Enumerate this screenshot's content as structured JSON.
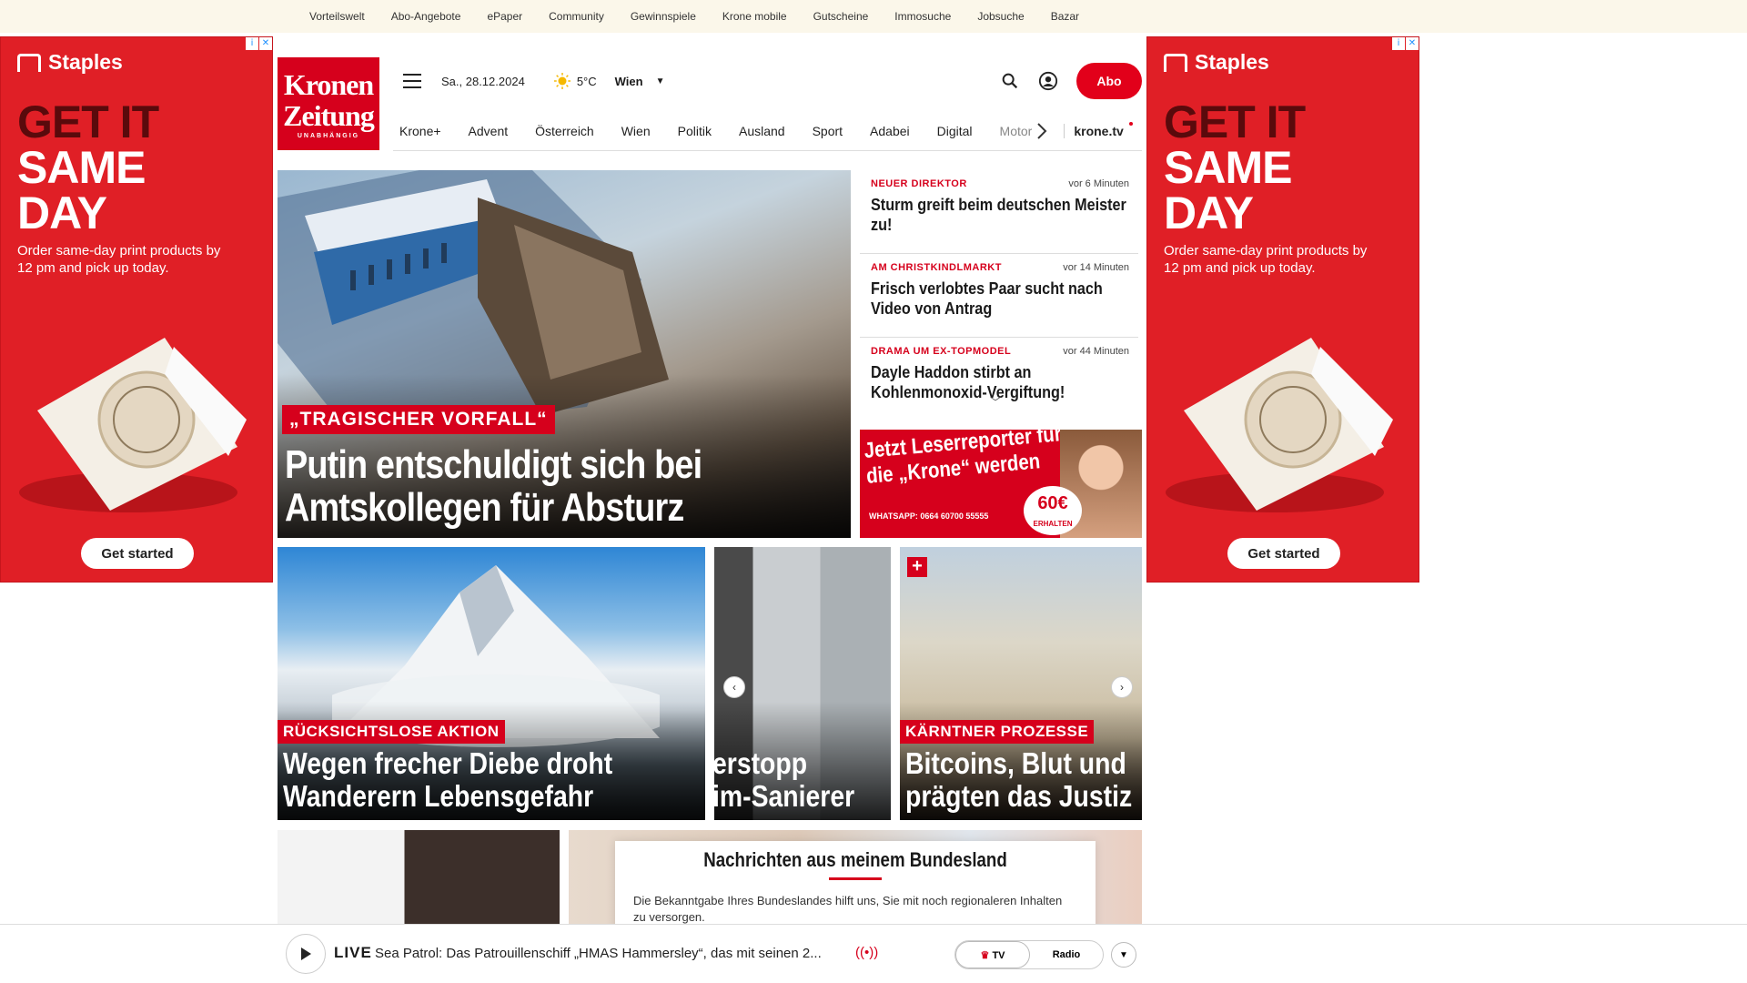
{
  "topbar": [
    "Vorteilswelt",
    "Abo-Angebote",
    "ePaper",
    "Community",
    "Gewinnspiele",
    "Krone mobile",
    "Gutscheine",
    "Immosuche",
    "Jobsuche",
    "Bazar"
  ],
  "ad": {
    "brand": "Staples",
    "line1": "GET IT",
    "line2": "SAME",
    "line3": "DAY",
    "sub": "Order same-day print products by 12 pm and pick up today.",
    "cta": "Get started",
    "adchoice_i": "i",
    "adchoice_x": "✕",
    "accent": "#e01f26"
  },
  "logo": {
    "l1": "Kronen",
    "l2": "Zeitung",
    "l3": "UNABHÄNGIG"
  },
  "header": {
    "date": "Sa., 28.12.2024",
    "temp": "5°C",
    "city": "Wien",
    "abo": "Abo"
  },
  "nav": [
    "Krone+",
    "Advent",
    "Österreich",
    "Wien",
    "Politik",
    "Ausland",
    "Sport",
    "Adabei",
    "Digital"
  ],
  "nav_more": "Motor",
  "nav_tv": "krone.tv",
  "hero": {
    "kicker": "„TRAGISCHER VORFALL“",
    "title": "Putin entschuldigt sich bei Amtskollegen für Absturz"
  },
  "news": [
    {
      "cat": "NEUER DIREKTOR",
      "time": "vor 6 Minuten",
      "title": "Sturm greift beim deutschen Meister zu!"
    },
    {
      "cat": "AM CHRISTKINDLMARKT",
      "time": "vor 14 Minuten",
      "title": "Frisch verlobtes Paar sucht nach Video von Antrag"
    },
    {
      "cat": "DRAMA UM EX-TOPMODEL",
      "time": "vor 44 Minuten",
      "title": "Dayle Haddon stirbt an Kohlenmonoxid-Vergiftung!"
    }
  ],
  "promo": {
    "text": "Jetzt Leserreporter für die „Krone“ werden",
    "whatsapp": "WHATSAPP: 0664 60700 55555",
    "amount": "60€",
    "amount_sub": "ERHALTEN"
  },
  "tiles": [
    {
      "kicker": "RÜCKSICHTSLOSE AKTION",
      "title1": "Wegen frecher Diebe droht",
      "title2": "Wanderern Lebensgefahr"
    },
    {
      "kicker": "",
      "title1": "erstopp",
      "title2": "im-Sanierer"
    },
    {
      "kicker": "KÄRNTNER PROZESSE",
      "title1": "Bitcoins, Blut und",
      "title2": "prägten das Justiz"
    }
  ],
  "modal": {
    "title": "Nachrichten aus meinem Bundesland",
    "body": "Die Bekanntgabe Ihres Bundeslandes hilft uns, Sie mit noch regionaleren Inhalten zu versorgen."
  },
  "live": {
    "label": "LIVE",
    "text": "Sea Patrol: Das Patrouillenschiff „HMAS Hammersley“, das mit seinen 2...",
    "tv": "TV",
    "radio": "Radio"
  }
}
